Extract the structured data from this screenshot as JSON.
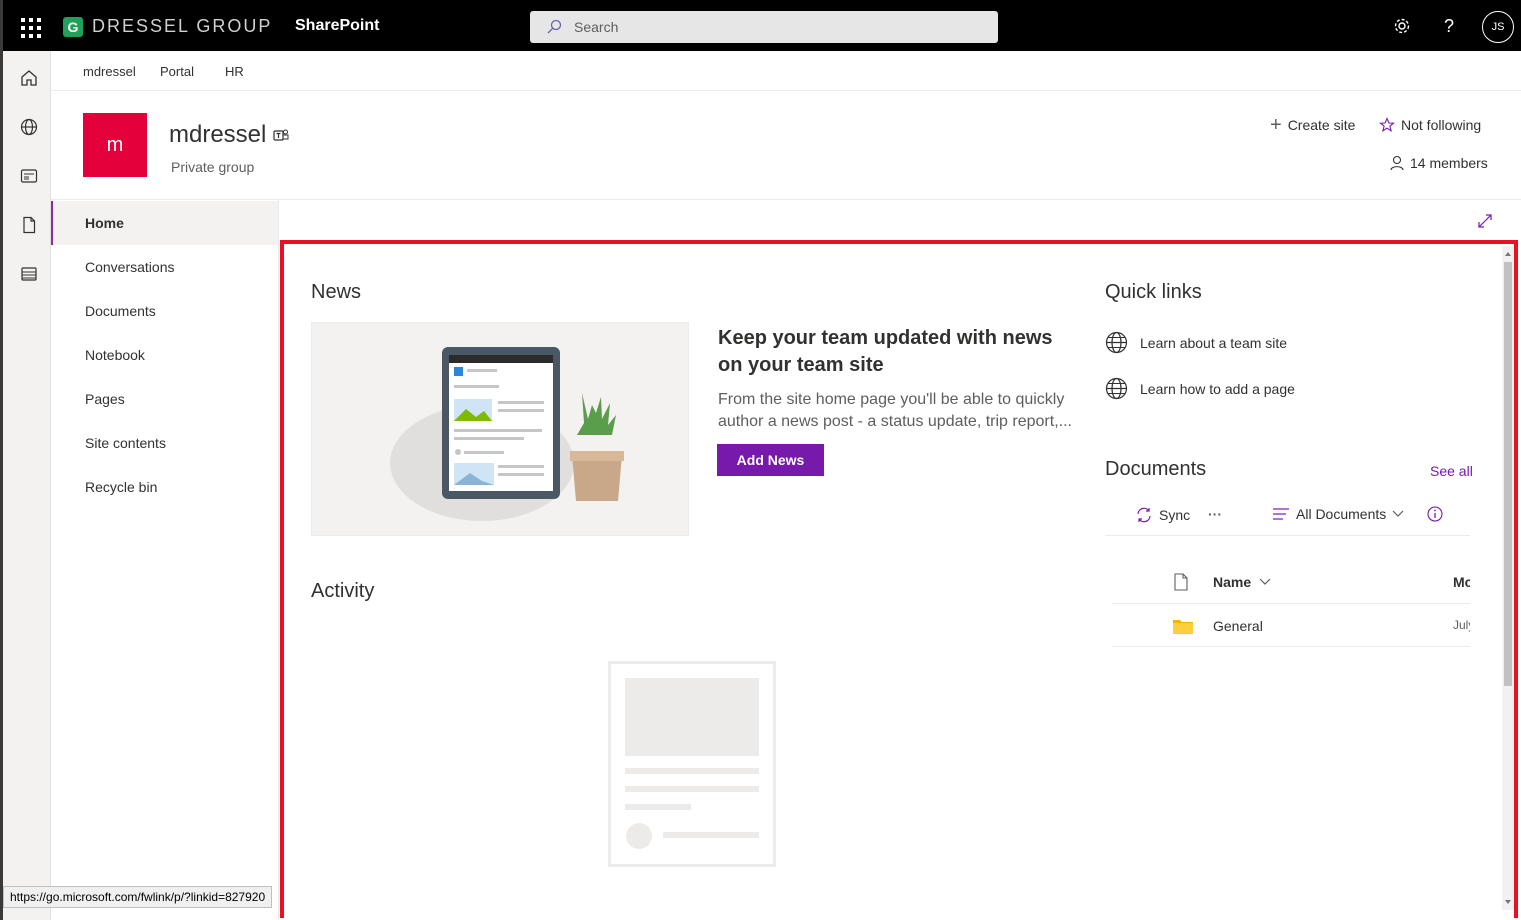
{
  "suitebar": {
    "brand_logo_letter": "G",
    "brand_name": "DRESSEL GROUP",
    "app_name": "SharePoint",
    "search_placeholder": "Search",
    "avatar_initials": "JS"
  },
  "hubnav": {
    "items": [
      "mdressel",
      "Portal",
      "HR"
    ]
  },
  "site": {
    "logo_letter": "m",
    "title": "mdressel",
    "subtitle": "Private group",
    "create_site": "Create site",
    "follow": "Not following",
    "members": "14 members"
  },
  "leftnav": {
    "items": [
      "Home",
      "Conversations",
      "Documents",
      "Notebook",
      "Pages",
      "Site contents",
      "Recycle bin"
    ]
  },
  "news": {
    "title": "News",
    "headline": "Keep your team updated with news on your team site",
    "description": "From the site home page you'll be able to quickly author a news post - a status update, trip report,...",
    "button": "Add News"
  },
  "activity": {
    "title": "Activity"
  },
  "quicklinks": {
    "title": "Quick links",
    "items": [
      "Learn about a team site",
      "Learn how to add a page"
    ]
  },
  "documents": {
    "title": "Documents",
    "see_all": "See all",
    "sync": "Sync",
    "more": "···",
    "view": "All Documents",
    "col_name": "Name",
    "col_modified": "Mc",
    "rows": [
      {
        "name": "General",
        "modified": "July"
      }
    ]
  },
  "statusbar": {
    "url": "https://go.microsoft.com/fwlink/p/?linkid=827920"
  },
  "colors": {
    "accent": "#7719aa",
    "site_logo": "#e4003a",
    "highlight_box": "#e81123"
  }
}
